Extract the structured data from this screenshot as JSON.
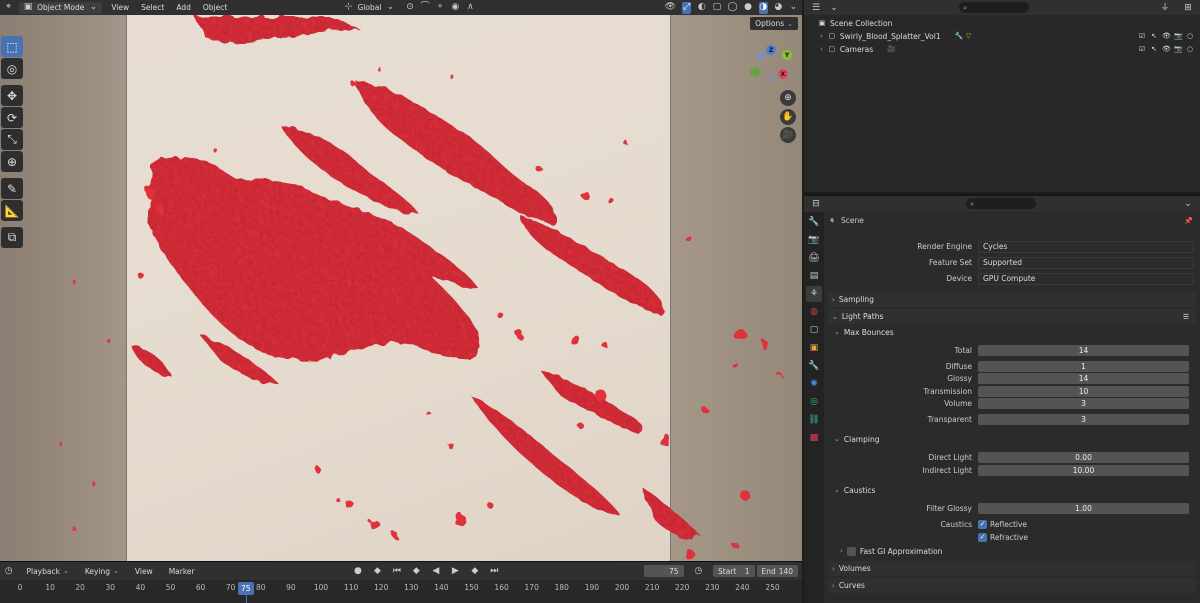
{
  "viewport_header": {
    "mode": "Object Mode",
    "menus": [
      "View",
      "Select",
      "Add",
      "Object"
    ],
    "transform_orientation": "Global",
    "options_label": "Options"
  },
  "tools": [
    "select-box",
    "cursor",
    "move",
    "rotate",
    "scale",
    "transform",
    "annotate",
    "measure",
    "add-cube"
  ],
  "timeline": {
    "menus": [
      "Playback",
      "Keying",
      "View",
      "Marker"
    ],
    "current_frame": "75",
    "start_label": "Start",
    "start_value": "1",
    "end_label": "End",
    "end_value": "140",
    "ruler_ticks": [
      "0",
      "10",
      "20",
      "30",
      "40",
      "50",
      "60",
      "70",
      "80",
      "90",
      "100",
      "110",
      "120",
      "130",
      "140",
      "150",
      "160",
      "170",
      "180",
      "190",
      "200",
      "210",
      "220",
      "230",
      "240",
      "250"
    ],
    "playhead": "75"
  },
  "outliner": {
    "root": "Scene Collection",
    "items": [
      {
        "name": "Swirly_Blood_Splatter_Vol1"
      },
      {
        "name": "Cameras"
      }
    ]
  },
  "properties": {
    "context": "Scene",
    "render_engine_label": "Render Engine",
    "render_engine": "Cycles",
    "feature_set_label": "Feature Set",
    "feature_set": "Supported",
    "device_label": "Device",
    "device": "GPU Compute",
    "panels": {
      "sampling": "Sampling",
      "light_paths": "Light Paths",
      "max_bounces": "Max Bounces",
      "clamping": "Clamping",
      "caustics": "Caustics",
      "fast_gi": "Fast GI Approximation",
      "volumes": "Volumes",
      "curves": "Curves"
    },
    "bounces": [
      {
        "label": "Total",
        "value": "14"
      },
      {
        "label": "Diffuse",
        "value": "1"
      },
      {
        "label": "Glossy",
        "value": "14"
      },
      {
        "label": "Transmission",
        "value": "10"
      },
      {
        "label": "Volume",
        "value": "3"
      },
      {
        "label": "Transparent",
        "value": "3"
      }
    ],
    "clamping": [
      {
        "label": "Direct Light",
        "value": "0.00"
      },
      {
        "label": "Indirect Light",
        "value": "10.00"
      }
    ],
    "filter_glossy_label": "Filter Glossy",
    "filter_glossy": "1.00",
    "caustics_label": "Caustics",
    "reflective": "Reflective",
    "refractive": "Refractive"
  },
  "colors": {
    "accent": "#4772b3",
    "blood": "#e03040",
    "panel_bg": "#2b2b2b"
  }
}
